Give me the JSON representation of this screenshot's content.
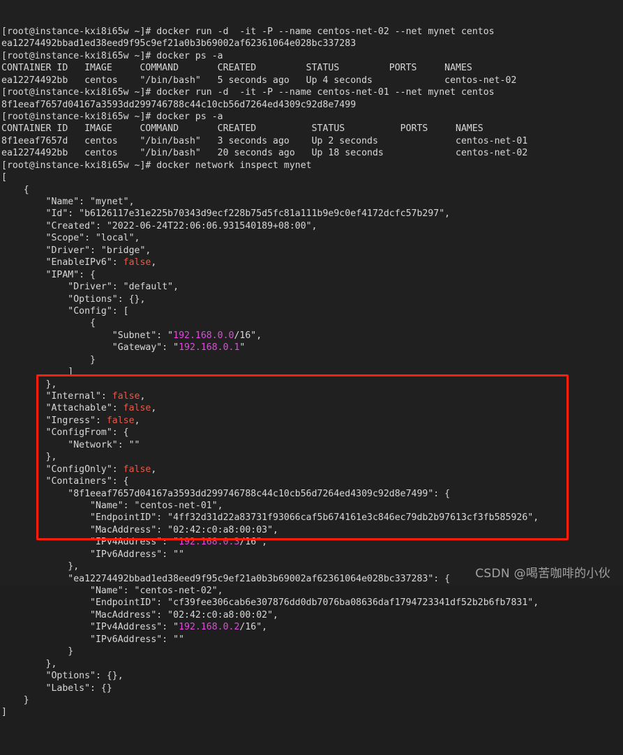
{
  "terminal": {
    "background_color": "#202020",
    "foreground_color": "#d8d8d8",
    "bool_color": "#e25c4b",
    "ip_color": "#e14ae1",
    "prompt": "[root@instance-kxi8i65w ~]#",
    "lines": [
      {
        "id": "l01",
        "text": "[root@instance-kxi8i65w ~]# docker run -d  -it -P --name centos-net-02 --net mynet centos"
      },
      {
        "id": "l02",
        "text": "ea12274492bbad1ed38eed9f95c9ef21a0b3b69002af62361064e028bc337283"
      },
      {
        "id": "l03",
        "text": "[root@instance-kxi8i65w ~]# docker ps -a"
      },
      {
        "id": "l04",
        "text": "CONTAINER ID   IMAGE     COMMAND       CREATED         STATUS         PORTS     NAMES"
      },
      {
        "id": "l05",
        "text": "ea12274492bb   centos    \"/bin/bash\"   5 seconds ago   Up 4 seconds             centos-net-02"
      },
      {
        "id": "l06",
        "text": "[root@instance-kxi8i65w ~]# docker run -d  -it -P --name centos-net-01 --net mynet centos"
      },
      {
        "id": "l07",
        "text": "8f1eeaf7657d04167a3593dd299746788c44c10cb56d7264ed4309c92d8e7499"
      },
      {
        "id": "l08",
        "text": "[root@instance-kxi8i65w ~]# docker ps -a"
      },
      {
        "id": "l09",
        "text": "CONTAINER ID   IMAGE     COMMAND       CREATED          STATUS          PORTS     NAMES"
      },
      {
        "id": "l10",
        "text": "8f1eeaf7657d   centos    \"/bin/bash\"   3 seconds ago    Up 2 seconds              centos-net-01"
      },
      {
        "id": "l11",
        "text": "ea12274492bb   centos    \"/bin/bash\"   20 seconds ago   Up 18 seconds             centos-net-02"
      },
      {
        "id": "l12",
        "text": "[root@instance-kxi8i65w ~]# docker network inspect mynet"
      },
      {
        "id": "l13",
        "text": "["
      },
      {
        "id": "l14",
        "text": "    {"
      },
      {
        "id": "l15",
        "segments": [
          {
            "t": "        \"Name\": \"mynet\",",
            "c": "c-default"
          }
        ]
      },
      {
        "id": "l16",
        "segments": [
          {
            "t": "        \"Id\": \"b6126117e31e225b70343d9ecf228b75d5fc81a111b9e9c0ef4172dcfc57b297\",",
            "c": "c-default"
          }
        ]
      },
      {
        "id": "l17",
        "segments": [
          {
            "t": "        \"Created\": \"2022-06-24T22:06:06.931540189+08:00\",",
            "c": "c-default"
          }
        ]
      },
      {
        "id": "l18",
        "segments": [
          {
            "t": "        \"Scope\": \"local\",",
            "c": "c-default"
          }
        ]
      },
      {
        "id": "l19",
        "segments": [
          {
            "t": "        \"Driver\": \"bridge\",",
            "c": "c-default"
          }
        ]
      },
      {
        "id": "l20",
        "segments": [
          {
            "t": "        \"EnableIPv6\": ",
            "c": "c-default"
          },
          {
            "t": "false",
            "c": "c-bool"
          },
          {
            "t": ",",
            "c": "c-default"
          }
        ]
      },
      {
        "id": "l21",
        "segments": [
          {
            "t": "        \"IPAM\": {",
            "c": "c-default"
          }
        ]
      },
      {
        "id": "l22",
        "segments": [
          {
            "t": "            \"Driver\": \"default\",",
            "c": "c-default"
          }
        ]
      },
      {
        "id": "l23",
        "segments": [
          {
            "t": "            \"Options\": {},",
            "c": "c-default"
          }
        ]
      },
      {
        "id": "l24",
        "segments": [
          {
            "t": "            \"Config\": [",
            "c": "c-default"
          }
        ]
      },
      {
        "id": "l25",
        "segments": [
          {
            "t": "                {",
            "c": "c-default"
          }
        ]
      },
      {
        "id": "l26",
        "segments": [
          {
            "t": "                    \"Subnet\": \"",
            "c": "c-default"
          },
          {
            "t": "192.168.0.0",
            "c": "c-ip"
          },
          {
            "t": "/16\",",
            "c": "c-default"
          }
        ]
      },
      {
        "id": "l27",
        "segments": [
          {
            "t": "                    \"Gateway\": \"",
            "c": "c-default"
          },
          {
            "t": "192.168.0.1",
            "c": "c-ip"
          },
          {
            "t": "\"",
            "c": "c-default"
          }
        ]
      },
      {
        "id": "l28",
        "segments": [
          {
            "t": "                }",
            "c": "c-default"
          }
        ]
      },
      {
        "id": "l29",
        "segments": [
          {
            "t": "            ]",
            "c": "c-default"
          }
        ]
      },
      {
        "id": "l30",
        "segments": [
          {
            "t": "        },",
            "c": "c-default"
          }
        ]
      },
      {
        "id": "l31",
        "segments": [
          {
            "t": "        \"Internal\": ",
            "c": "c-default"
          },
          {
            "t": "false",
            "c": "c-bool"
          },
          {
            "t": ",",
            "c": "c-default"
          }
        ]
      },
      {
        "id": "l32",
        "segments": [
          {
            "t": "        \"Attachable\": ",
            "c": "c-default"
          },
          {
            "t": "false",
            "c": "c-bool"
          },
          {
            "t": ",",
            "c": "c-default"
          }
        ]
      },
      {
        "id": "l33",
        "segments": [
          {
            "t": "        \"Ingress\": ",
            "c": "c-default"
          },
          {
            "t": "false",
            "c": "c-bool"
          },
          {
            "t": ",",
            "c": "c-default"
          }
        ]
      },
      {
        "id": "l34",
        "segments": [
          {
            "t": "        \"ConfigFrom\": {",
            "c": "c-default"
          }
        ]
      },
      {
        "id": "l35",
        "segments": [
          {
            "t": "            \"Network\": \"\"",
            "c": "c-default"
          }
        ]
      },
      {
        "id": "l36",
        "segments": [
          {
            "t": "        },",
            "c": "c-default"
          }
        ]
      },
      {
        "id": "l37",
        "segments": [
          {
            "t": "        \"ConfigOnly\": ",
            "c": "c-default"
          },
          {
            "t": "false",
            "c": "c-bool"
          },
          {
            "t": ",",
            "c": "c-default"
          }
        ]
      },
      {
        "id": "l38",
        "segments": [
          {
            "t": "        \"Containers\": {",
            "c": "c-default"
          }
        ]
      },
      {
        "id": "l39",
        "segments": [
          {
            "t": "            \"8f1eeaf7657d04167a3593dd299746788c44c10cb56d7264ed4309c92d8e7499\": {",
            "c": "c-default"
          }
        ]
      },
      {
        "id": "l40",
        "segments": [
          {
            "t": "                \"Name\": \"centos-net-01\",",
            "c": "c-default"
          }
        ]
      },
      {
        "id": "l41",
        "segments": [
          {
            "t": "                \"EndpointID\": \"4ff32d31d22a83731f93066caf5b674161e3c846ec79db2b97613cf3fb585926\",",
            "c": "c-default"
          }
        ]
      },
      {
        "id": "l42",
        "segments": [
          {
            "t": "                \"MacAddress\": \"02:42:c0:a8:00:03\",",
            "c": "c-default"
          }
        ]
      },
      {
        "id": "l43",
        "segments": [
          {
            "t": "                \"IPv4Address\": \"",
            "c": "c-default"
          },
          {
            "t": "192.168.0.3",
            "c": "c-ip"
          },
          {
            "t": "/16\",",
            "c": "c-default"
          }
        ]
      },
      {
        "id": "l44",
        "segments": [
          {
            "t": "                \"IPv6Address\": \"\"",
            "c": "c-default"
          }
        ]
      },
      {
        "id": "l45",
        "segments": [
          {
            "t": "            },",
            "c": "c-default"
          }
        ]
      },
      {
        "id": "l46",
        "segments": [
          {
            "t": "            \"ea12274492bbad1ed38eed9f95c9ef21a0b3b69002af62361064e028bc337283\": {",
            "c": "c-default"
          }
        ]
      },
      {
        "id": "l47",
        "segments": [
          {
            "t": "                \"Name\": \"centos-net-02\",",
            "c": "c-default"
          }
        ]
      },
      {
        "id": "l48",
        "segments": [
          {
            "t": "                \"EndpointID\": \"cf39fee306cab6e307876dd0db7076ba08636daf1794723341df52b2b6fb7831\",",
            "c": "c-default"
          }
        ]
      },
      {
        "id": "l49",
        "segments": [
          {
            "t": "                \"MacAddress\": \"02:42:c0:a8:00:02\",",
            "c": "c-default"
          }
        ]
      },
      {
        "id": "l50",
        "segments": [
          {
            "t": "                \"IPv4Address\": \"",
            "c": "c-default"
          },
          {
            "t": "192.168.0.2",
            "c": "c-ip"
          },
          {
            "t": "/16\",",
            "c": "c-default"
          }
        ]
      },
      {
        "id": "l51",
        "segments": [
          {
            "t": "                \"IPv6Address\": \"\"",
            "c": "c-default"
          }
        ]
      },
      {
        "id": "l52",
        "segments": [
          {
            "t": "            }",
            "c": "c-default"
          }
        ]
      },
      {
        "id": "l53",
        "segments": [
          {
            "t": "        },",
            "c": "c-default"
          }
        ]
      },
      {
        "id": "l54",
        "segments": [
          {
            "t": "        \"Options\": {},",
            "c": "c-default"
          }
        ]
      },
      {
        "id": "l55",
        "segments": [
          {
            "t": "        \"Labels\": {}",
            "c": "c-default"
          }
        ]
      },
      {
        "id": "l56",
        "segments": [
          {
            "t": "    }",
            "c": "c-default"
          }
        ]
      },
      {
        "id": "l57",
        "segments": [
          {
            "t": "]",
            "c": "c-default"
          }
        ]
      }
    ]
  },
  "annotation": {
    "highlight_color": "#fd1d0b",
    "label": "containers-highlight-box"
  },
  "watermark": {
    "text": "CSDN @喝苦咖啡的小伙"
  }
}
